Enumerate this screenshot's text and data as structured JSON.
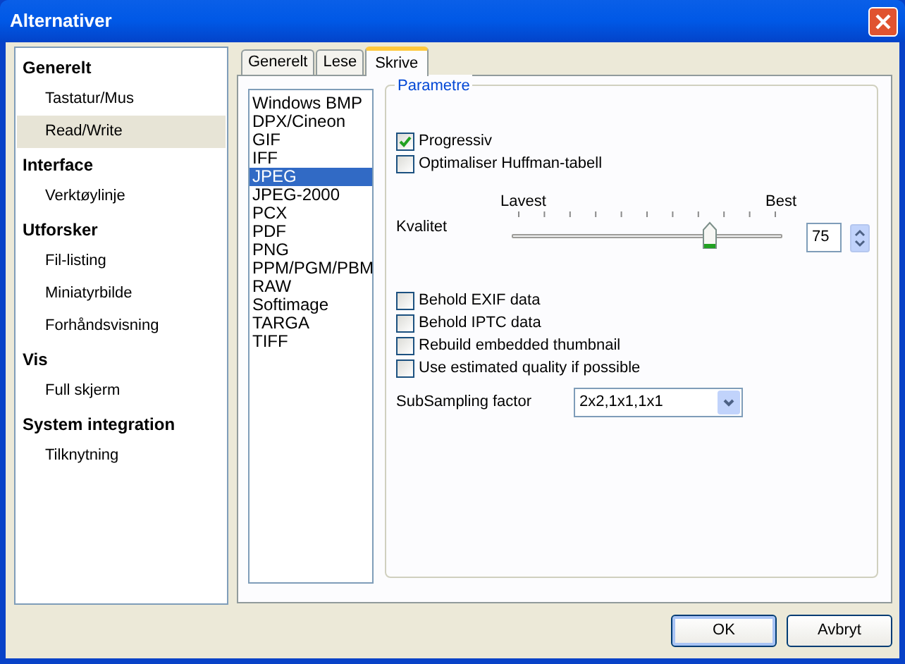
{
  "window": {
    "title": "Alternativer"
  },
  "sidebar": {
    "sections": [
      {
        "label": "Generelt",
        "selected": false,
        "children": [
          {
            "label": "Tastatur/Mus",
            "selected": false
          },
          {
            "label": "Read/Write",
            "selected": true
          }
        ]
      },
      {
        "label": "Interface",
        "selected": false,
        "children": [
          {
            "label": "Verktøylinje",
            "selected": false
          }
        ]
      },
      {
        "label": "Utforsker",
        "selected": false,
        "children": [
          {
            "label": "Fil-listing",
            "selected": false
          },
          {
            "label": "Miniatyrbilde",
            "selected": false
          },
          {
            "label": "Forhåndsvisning",
            "selected": false
          }
        ]
      },
      {
        "label": "Vis",
        "selected": false,
        "children": [
          {
            "label": "Full skjerm",
            "selected": false
          }
        ]
      },
      {
        "label": "System integration",
        "selected": false,
        "children": [
          {
            "label": "Tilknytning",
            "selected": false
          }
        ]
      }
    ]
  },
  "tabs": [
    {
      "label": "Generelt",
      "selected": false
    },
    {
      "label": "Lese",
      "selected": false
    },
    {
      "label": "Skrive",
      "selected": true
    }
  ],
  "formats": [
    {
      "label": "Windows BMP",
      "selected": false
    },
    {
      "label": "DPX/Cineon",
      "selected": false
    },
    {
      "label": "GIF",
      "selected": false
    },
    {
      "label": "IFF",
      "selected": false
    },
    {
      "label": "JPEG",
      "selected": true
    },
    {
      "label": "JPEG-2000",
      "selected": false
    },
    {
      "label": "PCX",
      "selected": false
    },
    {
      "label": "PDF",
      "selected": false
    },
    {
      "label": "PNG",
      "selected": false
    },
    {
      "label": "PPM/PGM/PBM",
      "selected": false
    },
    {
      "label": "RAW",
      "selected": false
    },
    {
      "label": "Softimage",
      "selected": false
    },
    {
      "label": "TARGA",
      "selected": false
    },
    {
      "label": "TIFF",
      "selected": false
    }
  ],
  "group": {
    "title": "Parametre",
    "options_top": [
      {
        "label": "Progressiv",
        "checked": true
      },
      {
        "label": "Optimaliser Huffman-tabell",
        "checked": false
      }
    ],
    "quality": {
      "label": "Kvalitet",
      "low_label": "Lavest",
      "high_label": "Best",
      "level": 0.74,
      "value": "75"
    },
    "options_bottom": [
      {
        "label": "Behold EXIF data",
        "checked": false
      },
      {
        "label": "Behold IPTC data",
        "checked": false
      },
      {
        "label": "Rebuild embedded thumbnail",
        "checked": false
      },
      {
        "label": "Use estimated quality if possible",
        "checked": false
      }
    ],
    "subsampling": {
      "label": "SubSampling factor",
      "value": "2x2,1x1,1x1"
    }
  },
  "buttons": [
    {
      "label": "OK",
      "default": true
    },
    {
      "label": "Avbryt",
      "default": false
    }
  ]
}
